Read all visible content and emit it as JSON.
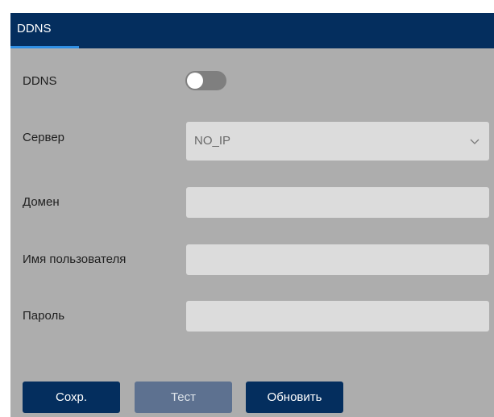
{
  "header": {
    "tabs": [
      {
        "label": "DDNS",
        "active": true
      }
    ]
  },
  "form": {
    "ddns": {
      "label": "DDNS",
      "enabled": false
    },
    "server": {
      "label": "Сервер",
      "value": "NO_IP"
    },
    "domain": {
      "label": "Домен",
      "value": ""
    },
    "username": {
      "label": "Имя пользователя",
      "value": ""
    },
    "password": {
      "label": "Пароль",
      "value": ""
    }
  },
  "buttons": {
    "save": "Сохр.",
    "test": "Тест",
    "refresh": "Обновить"
  },
  "colors": {
    "header_bg": "#042e5e",
    "tab_underline": "#2f8fe4",
    "panel_bg": "#adadad",
    "field_bg": "#dcdcdc",
    "primary_button": "#042e5e",
    "disabled_button": "#5d7190"
  },
  "icons": {
    "select_arrow": "chevron-down-icon"
  }
}
